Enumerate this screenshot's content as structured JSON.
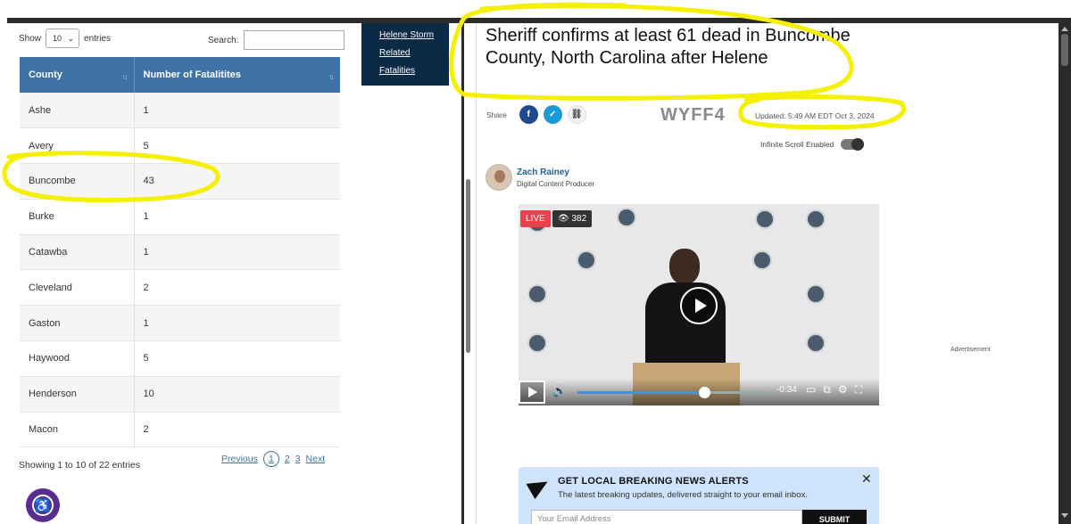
{
  "table_panel": {
    "show_label": "Show",
    "show_value": "10",
    "entries_label": "entries",
    "search_label": "Search:",
    "columns": [
      "County",
      "Number of Fatalitites"
    ],
    "rows": [
      [
        "Ashe",
        "1"
      ],
      [
        "Avery",
        "5"
      ],
      [
        "Buncombe",
        "43"
      ],
      [
        "Burke",
        "1"
      ],
      [
        "Catawba",
        "1"
      ],
      [
        "Cleveland",
        "2"
      ],
      [
        "Gaston",
        "1"
      ],
      [
        "Haywood",
        "5"
      ],
      [
        "Henderson",
        "10"
      ],
      [
        "Macon",
        "2"
      ]
    ],
    "info": "Showing 1 to 10 of 22 entries",
    "pager": {
      "previous": "Previous",
      "pages": [
        "1",
        "2",
        "3"
      ],
      "next": "Next"
    }
  },
  "mid_nav": {
    "items": [
      "Helene Storm",
      "Related",
      "Fatalities"
    ]
  },
  "article": {
    "headline": "Sheriff confirms at least 61 dead in Buncombe County, North Carolina after Helene",
    "share_label": "Share",
    "logo": "WYFF4",
    "updated": "Updated: 5:49 AM EDT Oct 3, 2024",
    "infinite_scroll": "Infinite Scroll Enabled",
    "author_name": "Zach Rainey",
    "author_role": "Digital Content Producer",
    "video": {
      "live": "LIVE",
      "viewers": "382",
      "time": "-0:34",
      "progress": 0.64
    },
    "advertisement": "Advertisement",
    "alert": {
      "title": "GET LOCAL BREAKING NEWS ALERTS",
      "subtitle": "The latest breaking updates, delivered straight to your email inbox.",
      "email_placeholder": "Your Email Address",
      "submit": "SUBMIT"
    }
  },
  "colors": {
    "table_header": "#3f73a8",
    "nav_bg": "#0b2a46",
    "highlight": "#f5ef00",
    "alert_bg": "#cfe4fa"
  }
}
